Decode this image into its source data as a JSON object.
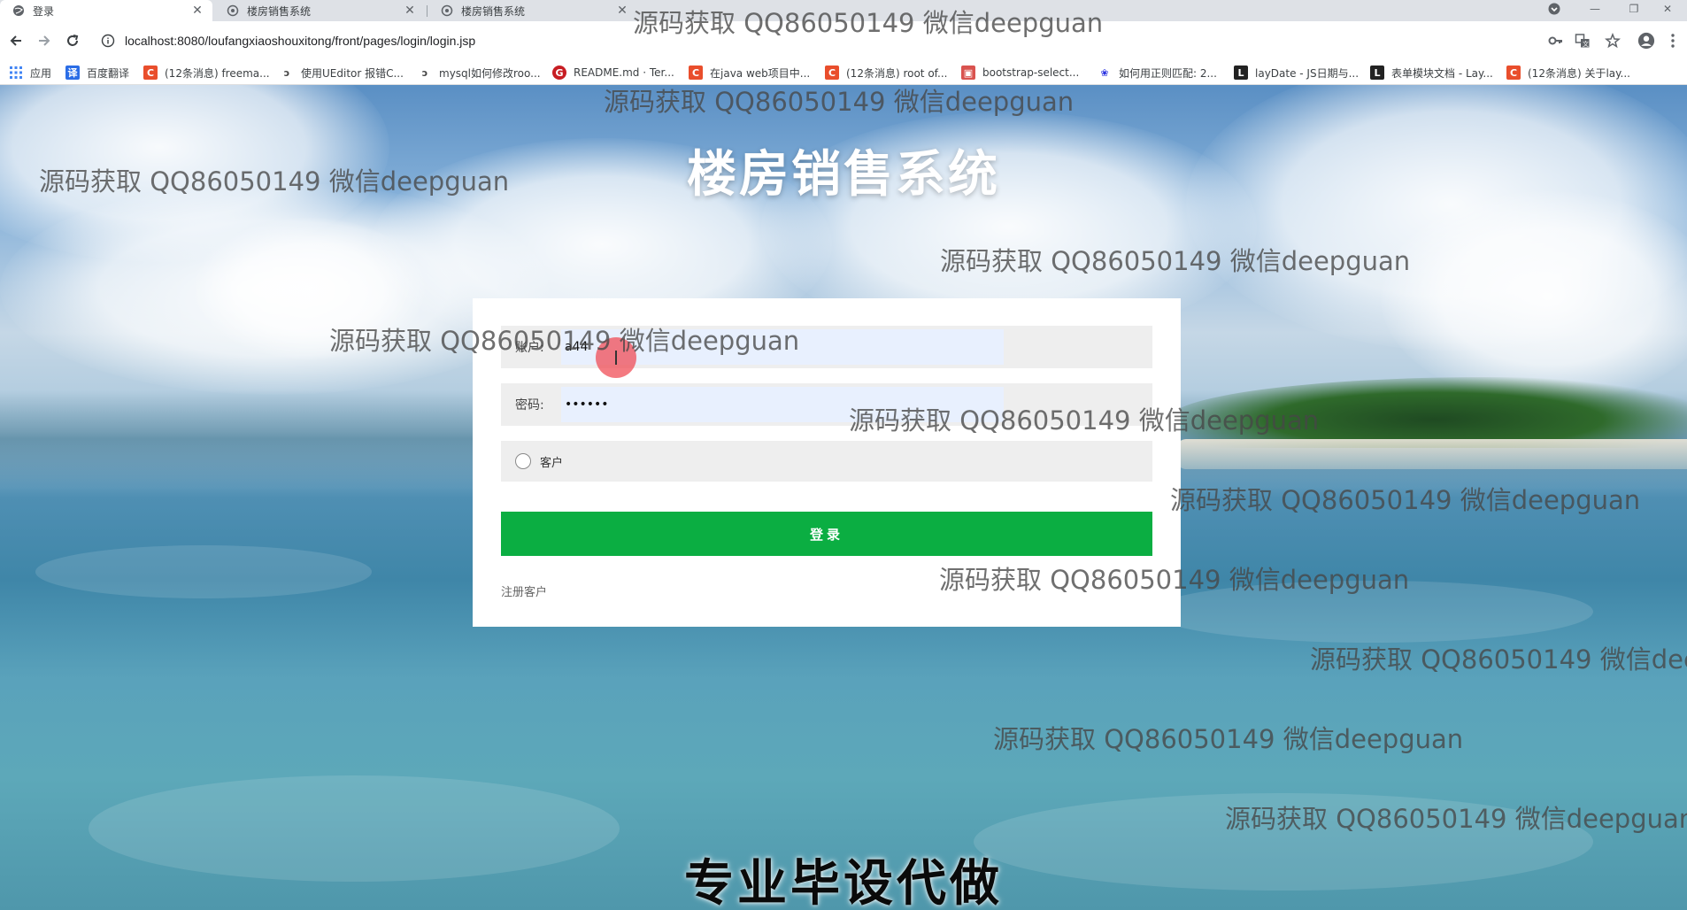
{
  "browser": {
    "tabs": [
      {
        "title": "登录",
        "active": true
      },
      {
        "title": "楼房销售系统",
        "active": false
      },
      {
        "title": "楼房销售系统",
        "active": false
      }
    ],
    "address": "localhost:8080/loufangxiaoshouxitong/front/pages/login/login.jsp",
    "bookmarks": [
      {
        "label": "应用",
        "icon": "apps-grid-icon",
        "color": "#4285f4"
      },
      {
        "label": "百度翻译",
        "icon": "baidu-translate-icon",
        "color": "#2b6de6"
      },
      {
        "label": "(12条消息) freema...",
        "icon": "csdn-icon",
        "color": "#e94e2c"
      },
      {
        "label": "使用UEditor 报错C...",
        "icon": "link-icon",
        "color": "#444444"
      },
      {
        "label": "mysql如何修改roo...",
        "icon": "link-icon",
        "color": "#444444"
      },
      {
        "label": "README.md · Ter...",
        "icon": "gitee-icon",
        "color": "#c71d23"
      },
      {
        "label": "在java web项目中...",
        "icon": "csdn-icon",
        "color": "#e94e2c"
      },
      {
        "label": "(12条消息) root of...",
        "icon": "csdn-icon",
        "color": "#e94e2c"
      },
      {
        "label": "bootstrap-select...",
        "icon": "site-icon",
        "color": "#d9534f"
      },
      {
        "label": "如何用正则匹配: 2...",
        "icon": "baidu-paw-icon",
        "color": "#2932e1"
      },
      {
        "label": "layDate - JS日期与...",
        "icon": "layui-icon",
        "color": "#222222"
      },
      {
        "label": "表单模块文档 - Lay...",
        "icon": "layui-icon",
        "color": "#222222"
      },
      {
        "label": "(12条消息) 关于lay...",
        "icon": "csdn-icon",
        "color": "#e94e2c"
      }
    ]
  },
  "page": {
    "title": "楼房销售系统",
    "account_label": "账户:",
    "account_value": "a44",
    "password_label": "密码:",
    "password_value": "123456",
    "role_option": "客户",
    "login_button": "登录",
    "register_link": "注册客户"
  },
  "overlay": {
    "watermark_text": "源码获取 QQ86050149 微信deepguan",
    "caption": "专业毕设代做"
  },
  "colors": {
    "login_button": "#0bae42",
    "cursor_highlight": "#f04650"
  }
}
